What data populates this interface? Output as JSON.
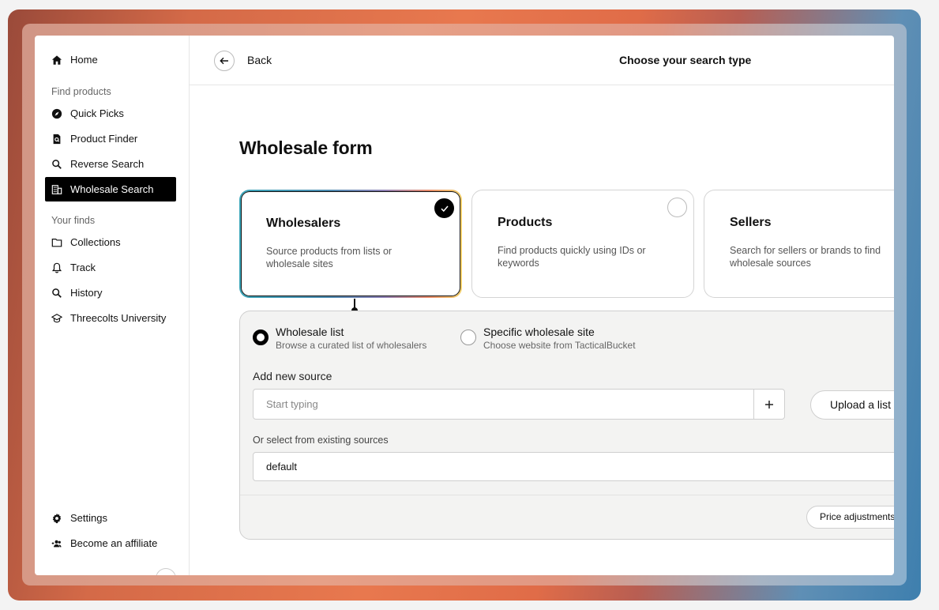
{
  "sidebar": {
    "home": "Home",
    "find_products_label": "Find products",
    "quick_picks": "Quick Picks",
    "product_finder": "Product Finder",
    "reverse_search": "Reverse Search",
    "wholesale_search": "Wholesale Search",
    "your_finds_label": "Your finds",
    "collections": "Collections",
    "track": "Track",
    "history": "History",
    "university": "Threecolts University",
    "settings": "Settings",
    "affiliate": "Become an affiliate"
  },
  "header": {
    "back_label": "Back",
    "title": "Choose your search type"
  },
  "main": {
    "form_title": "Wholesale form",
    "cards": [
      {
        "title": "Wholesalers",
        "desc": "Source products from lists or wholesale sites",
        "selected": true
      },
      {
        "title": "Products",
        "desc": "Find products quickly using IDs or keywords",
        "selected": false
      },
      {
        "title": "Sellers",
        "desc": "Search for sellers or brands to find wholesale sources",
        "selected": false
      }
    ],
    "options": [
      {
        "title": "Wholesale list",
        "sub": "Browse a curated list of wholesalers",
        "selected": true
      },
      {
        "title": "Specific wholesale site",
        "sub": "Choose website from TacticalBucket",
        "selected": false
      }
    ],
    "add_source_label": "Add new source",
    "source_placeholder": "Start typing",
    "upload_label": "Upload a list",
    "existing_label": "Or select from existing sources",
    "existing_value": "default",
    "price_adjustments": "Price adjustments"
  },
  "colors": {
    "accent": "#000000",
    "frame_gradient_start": "#d46a48",
    "frame_gradient_end": "#3e7fae"
  }
}
